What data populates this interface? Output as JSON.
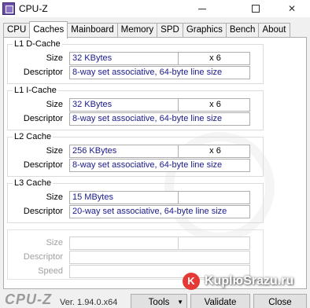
{
  "window": {
    "title": "CPU-Z",
    "close_glyph": "✕"
  },
  "tabs": [
    "CPU",
    "Caches",
    "Mainboard",
    "Memory",
    "SPD",
    "Graphics",
    "Bench",
    "About"
  ],
  "active_tab": "Caches",
  "caches": {
    "l1d": {
      "title": "L1 D-Cache",
      "size_label": "Size",
      "descriptor_label": "Descriptor",
      "size": "32 KBytes",
      "multiplier": "x 6",
      "descriptor": "8-way set associative, 64-byte line size"
    },
    "l1i": {
      "title": "L1 I-Cache",
      "size_label": "Size",
      "descriptor_label": "Descriptor",
      "size": "32 KBytes",
      "multiplier": "x 6",
      "descriptor": "8-way set associative, 64-byte line size"
    },
    "l2": {
      "title": "L2 Cache",
      "size_label": "Size",
      "descriptor_label": "Descriptor",
      "size": "256 KBytes",
      "multiplier": "x 6",
      "descriptor": "8-way set associative, 64-byte line size"
    },
    "l3": {
      "title": "L3 Cache",
      "size_label": "Size",
      "descriptor_label": "Descriptor",
      "size": "15 MBytes",
      "multiplier": "",
      "descriptor": "20-way set associative, 64-byte line size"
    }
  },
  "disabled_group": {
    "size_label": "Size",
    "descriptor_label": "Descriptor",
    "speed_label": "Speed"
  },
  "footer": {
    "brand": "CPU-Z",
    "version": "Ver. 1.94.0.x64",
    "tools_label": "Tools",
    "validate_label": "Validate",
    "close_label": "Close"
  },
  "promo": {
    "icon": "K",
    "text": "KuplюSrazu.ru"
  }
}
